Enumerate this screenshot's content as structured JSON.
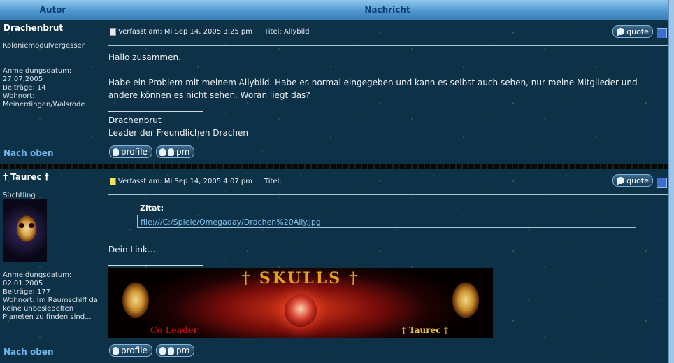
{
  "header": {
    "author_label": "Autor",
    "message_label": "Nachricht"
  },
  "posts": [
    {
      "author": "Drachenbrut",
      "rank": "Koloniemodulvergesser",
      "reg_label": "Anmeldungsdatum:",
      "reg_date": "27.07.2005",
      "posts": "Beiträge: 14",
      "location": "Wohnort: Meinerdingen/Walsrode",
      "meta": "Verfasst am: Mi Sep 14, 2005 3:25 pm",
      "title": "Titel: Allybild",
      "quote_label": "quote",
      "body": [
        "Hallo zusammen.",
        "Habe ein Problem mit meinem Allybild. Habe es normal eingegeben und kann es selbst auch sehen, nur meine Mitglieder und andere können es nicht sehen. Woran liegt das?"
      ],
      "signature": [
        "Drachenbrut",
        "Leader der Freundlichen Drachen"
      ],
      "back_to_top": "Nach oben",
      "profile_label": "profile",
      "pm_label": "pm"
    },
    {
      "author": "† Taurec †",
      "rank": "Süchtling",
      "reg_label": "Anmeldungsdatum:",
      "reg_date": "02.01.2005",
      "posts": "Beiträge: 177",
      "location": "Wohnort: Im Raumschiff da keine unbesiedelten Planeten zu finden sind...",
      "meta": "Verfasst am: Mi Sep 14, 2005 4:07 pm",
      "title": "Titel:",
      "quote_label": "quote",
      "quote_heading": "Zitat:",
      "quote_text": "file:///C:/Spiele/Omegaday/Drachen%20Ally.jpg",
      "body": [
        "Dein Link..."
      ],
      "signature_banner": {
        "title": "† SKULLS †",
        "rank": "Co Leader",
        "name": "† Taurec †"
      },
      "back_to_top": "Nach oben",
      "profile_label": "profile",
      "pm_label": "pm"
    }
  ]
}
